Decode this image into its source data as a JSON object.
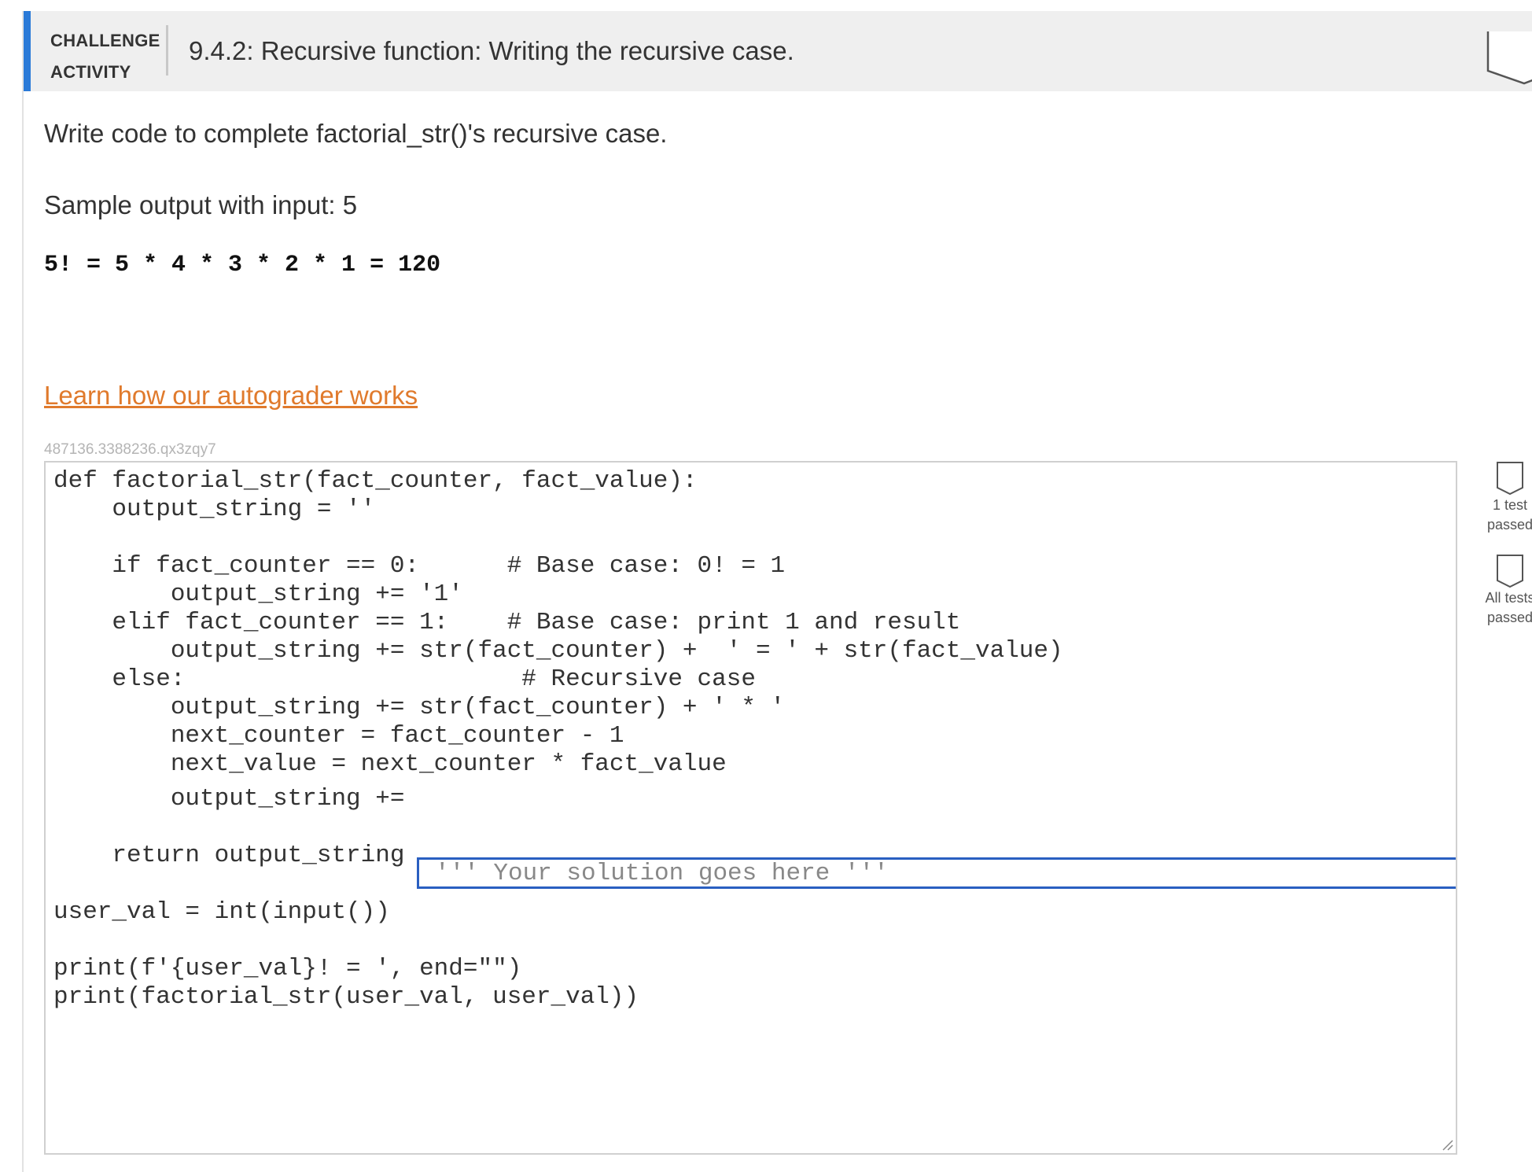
{
  "header": {
    "activity_type_line1": "CHALLENGE",
    "activity_type_line2": "ACTIVITY",
    "title": "9.4.2: Recursive function: Writing the recursive case."
  },
  "instructions": "Write code to complete factorial_str()'s recursive case.",
  "sample": {
    "label": "Sample output with input: 5",
    "output": "5! = 5 * 4 * 3 * 2 * 1 = 120"
  },
  "autograder_link": "Learn how our autograder works",
  "activity_id": "487136.3388236.qx3zqy7",
  "editor": {
    "lines": [
      "def factorial_str(fact_counter, fact_value):",
      "    output_string = ''",
      "",
      "    if fact_counter == 0:      # Base case: 0! = 1",
      "        output_string += '1'",
      "    elif fact_counter == 1:    # Base case: print 1 and result",
      "        output_string += str(fact_counter) +  ' = ' + str(fact_value)",
      "    else:                       # Recursive case",
      "        output_string += str(fact_counter) + ' * '",
      "        next_counter = fact_counter - 1",
      "        next_value = next_counter * fact_value",
      "        output_string +=",
      "",
      "    return output_string",
      "",
      "user_val = int(input())",
      "",
      "print(f'{user_val}! = ', end=\"\")",
      "print(factorial_str(user_val, user_val))"
    ],
    "solution_value": "",
    "solution_placeholder": "''' Your solution goes here '''"
  },
  "status": {
    "test1_label": "1 test\npassed",
    "all_tests_label": "All tests\npassed"
  },
  "colors": {
    "accent_blue": "#2a7ad8",
    "link_orange": "#e07a2c",
    "input_border_blue": "#2a5fc1",
    "header_bg": "#efefef"
  }
}
